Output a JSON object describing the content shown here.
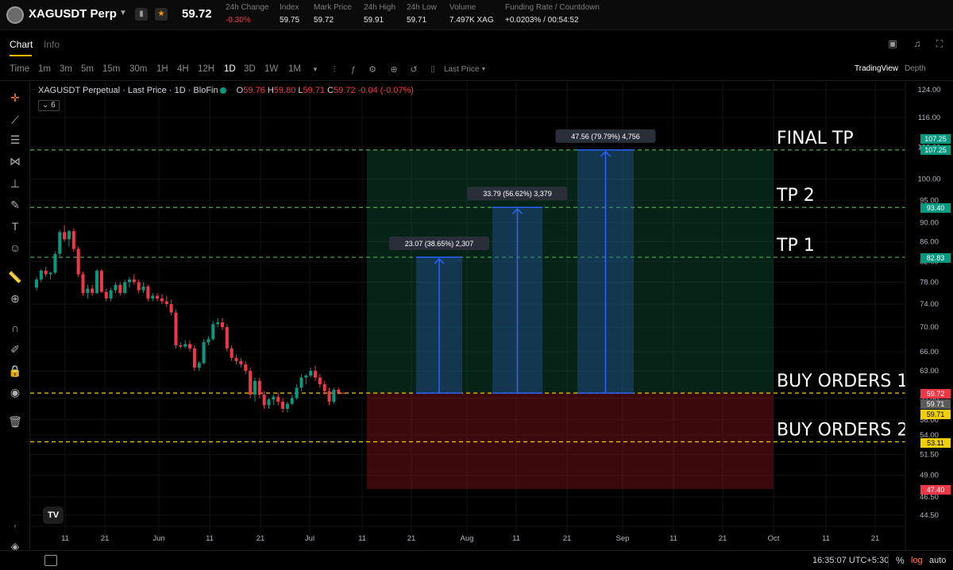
{
  "ticker": {
    "symbol": "XAGUSDT Perp",
    "last_price": "59.72",
    "stats": [
      {
        "label": "24h Change",
        "value": "-0.30%",
        "negative": true
      },
      {
        "label": "Index",
        "value": "59.75"
      },
      {
        "label": "Mark Price",
        "value": "59.72"
      },
      {
        "label": "24h High",
        "value": "59.91"
      },
      {
        "label": "24h Low",
        "value": "59.71"
      },
      {
        "label": "Volume",
        "value": "7.497K XAG"
      },
      {
        "label": "Funding Rate / Countdown",
        "value": "+0.0203% / 00:54:52"
      }
    ]
  },
  "tabs": {
    "chart": "Chart",
    "info": "Info"
  },
  "toolbar": {
    "time_label": "Time",
    "intervals": [
      "1m",
      "3m",
      "5m",
      "15m",
      "30m",
      "1H",
      "4H",
      "12H",
      "1D",
      "3D",
      "1W",
      "1M"
    ],
    "selected_interval": "1D",
    "price_type": "Last Price",
    "tradingview": "TradingView",
    "depth": "Depth"
  },
  "legend": {
    "title": "XAGUSDT Perpetual · Last Price · 1D · BloFin",
    "o_label": "O",
    "o": "59.76",
    "h_label": "H",
    "h": "59.80",
    "l_label": "L",
    "l": "59.71",
    "c_label": "C",
    "c": "59.72",
    "change": "-0.04 (-0.07%)",
    "indicator_count": "6",
    "tv_logo": "TV"
  },
  "chart_data": {
    "type": "candlestick",
    "y_axis_scale": "log",
    "y_ticks": [
      124.0,
      116.0,
      108.0,
      100.0,
      95.0,
      90.0,
      86.0,
      82.0,
      78.0,
      74.0,
      70.0,
      66.0,
      63.0,
      59.0,
      56.0,
      54.0,
      51.5,
      49.0,
      46.5,
      44.5
    ],
    "x_ticks": [
      "11",
      "21",
      "Jun",
      "11",
      "21",
      "Jul",
      "11",
      "21",
      "Aug",
      "11",
      "21",
      "Sep",
      "11",
      "21",
      "Oct",
      "11",
      "21"
    ],
    "price_labels": [
      {
        "value": "107.25",
        "color": "#089981"
      },
      {
        "value": "107.25",
        "color": "#089981"
      },
      {
        "value": "93.40",
        "color": "#089981"
      },
      {
        "value": "82.83",
        "color": "#089981"
      },
      {
        "value": "59.72",
        "color": "#f23645"
      },
      {
        "value": "59.71",
        "color": "#5a5a5a"
      },
      {
        "value": "59.71",
        "color": "#f0d000"
      },
      {
        "value": "53.11",
        "color": "#f0d000"
      },
      {
        "value": "47.40",
        "color": "#f23645"
      }
    ],
    "levels": [
      {
        "name": "FINAL TP",
        "price": 107.25,
        "color": "#4caf50"
      },
      {
        "name": "TP 2",
        "price": 93.4,
        "color": "#4caf50"
      },
      {
        "name": "TP 1",
        "price": 82.83,
        "color": "#4caf50"
      },
      {
        "name": "BUY ORDERS 1",
        "price": 59.72,
        "color": "#f0d000"
      },
      {
        "name": "BUY ORDERS 2",
        "price": 53.11,
        "color": "#f0d000"
      }
    ],
    "position": {
      "entry": 59.72,
      "target": 107.25,
      "stop": 47.4
    },
    "measures": [
      {
        "label": "23.07 (38.65%) 2,307",
        "from": 59.72,
        "to": 82.83
      },
      {
        "label": "33.79 (56.62%) 3,379",
        "from": 59.72,
        "to": 93.4
      },
      {
        "label": "47.56 (79.79%) 4,756",
        "from": 59.72,
        "to": 107.25
      }
    ],
    "candles": [
      [
        77.0,
        79.0,
        76.5,
        78.5
      ],
      [
        78.5,
        80.5,
        78.0,
        80.2
      ],
      [
        80.2,
        81.0,
        79.0,
        79.5
      ],
      [
        79.5,
        80.0,
        78.5,
        79.8
      ],
      [
        79.8,
        84.0,
        79.5,
        83.5
      ],
      [
        83.5,
        88.5,
        83.0,
        88.0
      ],
      [
        88.0,
        89.5,
        86.0,
        86.5
      ],
      [
        86.5,
        88.5,
        85.0,
        88.2
      ],
      [
        88.2,
        88.8,
        84.0,
        84.5
      ],
      [
        84.5,
        85.0,
        79.0,
        79.5
      ],
      [
        79.5,
        80.0,
        75.5,
        76.0
      ],
      [
        76.0,
        77.5,
        75.0,
        76.8
      ],
      [
        76.8,
        77.5,
        75.5,
        76.0
      ],
      [
        76.0,
        80.5,
        75.8,
        80.2
      ],
      [
        80.2,
        80.5,
        76.0,
        76.2
      ],
      [
        76.2,
        76.8,
        74.5,
        75.0
      ],
      [
        75.0,
        77.0,
        74.5,
        76.5
      ],
      [
        76.5,
        78.0,
        76.0,
        77.5
      ],
      [
        77.5,
        78.0,
        75.5,
        76.0
      ],
      [
        76.0,
        78.5,
        75.8,
        78.0
      ],
      [
        78.0,
        79.0,
        77.0,
        78.5
      ],
      [
        78.5,
        79.5,
        77.5,
        78.0
      ],
      [
        78.0,
        78.5,
        76.0,
        76.5
      ],
      [
        76.5,
        78.0,
        76.0,
        77.2
      ],
      [
        77.2,
        77.5,
        74.5,
        75.0
      ],
      [
        75.0,
        76.0,
        74.5,
        75.5
      ],
      [
        75.5,
        76.0,
        74.5,
        75.0
      ],
      [
        75.0,
        75.8,
        74.0,
        74.5
      ],
      [
        74.5,
        75.5,
        73.5,
        74.0
      ],
      [
        74.0,
        74.8,
        72.0,
        72.5
      ],
      [
        72.5,
        73.0,
        66.5,
        67.0
      ],
      [
        67.0,
        67.5,
        66.5,
        66.8
      ],
      [
        66.8,
        67.8,
        66.5,
        67.2
      ],
      [
        67.2,
        67.8,
        66.0,
        66.5
      ],
      [
        66.5,
        67.0,
        63.0,
        63.5
      ],
      [
        63.5,
        64.5,
        63.0,
        64.2
      ],
      [
        64.2,
        68.0,
        64.0,
        67.5
      ],
      [
        67.5,
        68.5,
        67.0,
        68.0
      ],
      [
        68.0,
        71.0,
        67.8,
        70.5
      ],
      [
        70.5,
        71.5,
        70.0,
        70.8
      ],
      [
        70.8,
        71.5,
        69.5,
        70.0
      ],
      [
        70.0,
        70.5,
        66.0,
        66.5
      ],
      [
        66.5,
        67.0,
        64.5,
        65.0
      ],
      [
        65.0,
        65.5,
        64.0,
        64.5
      ],
      [
        64.5,
        65.0,
        63.5,
        64.0
      ],
      [
        64.0,
        64.5,
        62.5,
        63.0
      ],
      [
        63.0,
        63.5,
        59.0,
        59.5
      ],
      [
        59.5,
        62.0,
        58.5,
        61.5
      ],
      [
        61.5,
        62.0,
        59.0,
        59.5
      ],
      [
        59.5,
        60.0,
        57.5,
        58.0
      ],
      [
        58.0,
        59.0,
        57.5,
        58.8
      ],
      [
        58.8,
        59.5,
        58.0,
        59.2
      ],
      [
        59.2,
        59.8,
        58.0,
        58.5
      ],
      [
        58.5,
        59.0,
        57.0,
        57.5
      ],
      [
        57.5,
        58.5,
        57.0,
        58.2
      ],
      [
        58.2,
        59.5,
        58.0,
        59.0
      ],
      [
        59.0,
        61.0,
        58.8,
        60.5
      ],
      [
        60.5,
        62.5,
        60.0,
        62.0
      ],
      [
        62.0,
        62.5,
        61.0,
        62.3
      ],
      [
        62.3,
        63.5,
        62.0,
        63.0
      ],
      [
        63.0,
        63.8,
        61.5,
        62.0
      ],
      [
        62.0,
        62.5,
        60.5,
        61.0
      ],
      [
        61.0,
        61.5,
        59.5,
        60.0
      ],
      [
        60.0,
        60.5,
        58.0,
        58.5
      ],
      [
        58.5,
        60.5,
        58.2,
        60.2
      ],
      [
        60.2,
        60.5,
        59.5,
        59.76
      ],
      [
        59.76,
        59.8,
        59.71,
        59.72
      ]
    ]
  },
  "bottom": {
    "clock": "16:35:07 UTC+5:30",
    "percent": "%",
    "log": "log",
    "auto": "auto"
  }
}
